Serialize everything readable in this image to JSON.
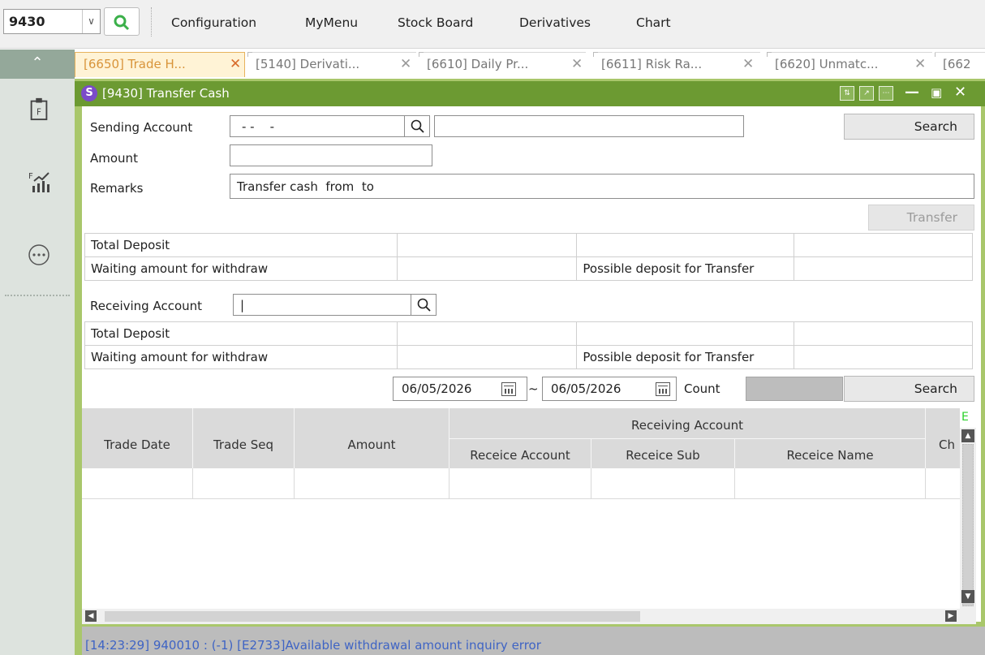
{
  "menubar": {
    "screen_code": "9430",
    "items": [
      "Configuration",
      "MyMenu",
      "Stock Board",
      "Derivatives",
      "Chart"
    ]
  },
  "tabs": [
    {
      "label": "[6650] Trade H...",
      "active": true
    },
    {
      "label": "[5140] Derivati...",
      "active": false
    },
    {
      "label": "[6610] Daily Pr...",
      "active": false
    },
    {
      "label": "[6611] Risk Ra...",
      "active": false
    },
    {
      "label": "[6620] Unmatc...",
      "active": false
    },
    {
      "label": "[662",
      "active": false
    }
  ],
  "window": {
    "title": "[9430] Transfer Cash"
  },
  "sending": {
    "label": "Sending Account",
    "account_value": "- -    -",
    "name_value": "",
    "search_label": "Search"
  },
  "amount": {
    "label": "Amount",
    "value": ""
  },
  "remarks": {
    "label": "Remarks",
    "value": "Transfer cash  from  to"
  },
  "transfer_label": "Transfer",
  "sending_info": {
    "total_deposit": "Total Deposit",
    "waiting": "Waiting amount for withdraw",
    "possible": "Possible deposit for Transfer"
  },
  "receiving": {
    "label": "Receiving Account",
    "account_value": "|"
  },
  "receiving_info": {
    "total_deposit": "Total Deposit",
    "waiting": "Waiting amount for withdraw",
    "possible": "Possible deposit for Transfer"
  },
  "filter": {
    "date_from": "06/05/2026",
    "tilde": "~",
    "date_to": "06/05/2026",
    "count_label": "Count",
    "count_value": "",
    "search_label": "Search"
  },
  "grid": {
    "columns": [
      "Trade Date",
      "Trade Seq",
      "Amount"
    ],
    "group_header": "Receiving Account",
    "sub_columns": [
      "Receice Account",
      "Receice Sub",
      "Receice Name"
    ],
    "last_column": "Ch",
    "excel_marker": "E",
    "rows": [
      [
        "",
        "",
        "",
        "",
        "",
        "",
        ""
      ]
    ]
  },
  "status": {
    "message": "[14:23:29] 940010 : (-1) [E2733]Available withdrawal amount inquiry error",
    "color": "#3f64c4"
  },
  "colors": {
    "window_title": "#6c9a32",
    "active_tab": "#d8943a"
  }
}
